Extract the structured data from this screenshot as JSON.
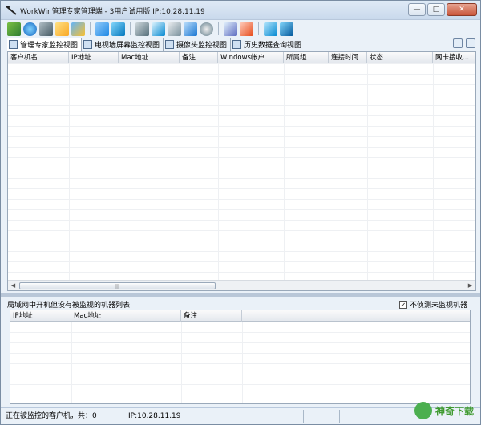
{
  "window": {
    "title": "WorkWin管理专家管理端 - 3用户试用版 IP:10.28.11.19"
  },
  "title_buttons": {
    "minimize": "—",
    "maximize": "□",
    "close": "✕"
  },
  "toolbar": {
    "icons": [
      "clients-icon",
      "network-icon",
      "settings-icon",
      "mail-icon",
      "users-icon",
      "edit-icon",
      "tools-icon",
      "monitor-icon",
      "screenshot-icon",
      "remote-icon",
      "copy-icon",
      "disk-icon",
      "report-icon",
      "export-icon",
      "chart-icon",
      "help-icon"
    ]
  },
  "tabs": [
    {
      "label": "管理专家监控视图"
    },
    {
      "label": "电视墙屏幕监控视图"
    },
    {
      "label": "摄像头监控视图"
    },
    {
      "label": "历史数据查询视图"
    }
  ],
  "main_table": {
    "columns": [
      "客户机名",
      "IP地址",
      "Mac地址",
      "备注",
      "Windows帐户",
      "所属组",
      "连接时间",
      "状态",
      "网卡接收..."
    ]
  },
  "scrollbar": {
    "left_arrow": "◀",
    "right_arrow": "▶",
    "grip": "|||"
  },
  "unmonitored": {
    "title": "局域网中开机但没有被监视的机器列表",
    "checkbox_label": "不侦测未监视机器",
    "checkbox_mark": "✓",
    "columns": [
      "IP地址",
      "Mac地址",
      "备注"
    ]
  },
  "statusbar": {
    "left": "正在被监控的客户机，共：0",
    "ip": "IP:10.28.11.19"
  },
  "watermark": {
    "text": "神奇下载"
  }
}
